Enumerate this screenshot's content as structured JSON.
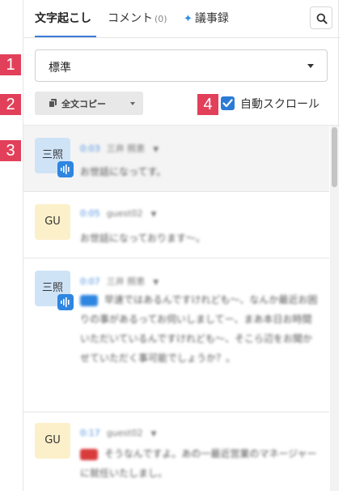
{
  "tabs": {
    "transcript": "文字起こし",
    "comment": "コメント",
    "comment_count": "(0)",
    "minutes": "議事録",
    "sparkle_icon": "sparkle-icon"
  },
  "search": {
    "icon": "search-icon"
  },
  "mode_select": {
    "value": "標準"
  },
  "copy_button": {
    "label": "全文コピー"
  },
  "auto_scroll": {
    "label": "自動スクロール",
    "checked": true
  },
  "markers": [
    "1",
    "2",
    "3",
    "4"
  ],
  "entries": [
    {
      "avatar": "三照",
      "time": "0:03",
      "name": "三井 照恵",
      "text": "お世話になってす。",
      "tag": ""
    },
    {
      "avatar": "GU",
      "time": "0:05",
      "name": "guest02",
      "text": "お世話になっております〜。",
      "tag": ""
    },
    {
      "avatar": "三照",
      "time": "0:07",
      "name": "三井 照恵",
      "text": "早速ではあるんですけれども〜、なんか最近お困りの事があるってお伺いしましてー、まあ本日お時間いただいているんですけれども〜、そこら辺をお聞かせていただく事可能でしょうか？。",
      "tag": "blue"
    },
    {
      "avatar": "GU",
      "time": "0:17",
      "name": "guest02",
      "text": "そうなんですよ。あの一最近営業のマネージャーに就任いたしまし。",
      "tag": "red"
    }
  ],
  "colors": {
    "accent": "#2b7bd6",
    "marker": "#e2405a"
  }
}
